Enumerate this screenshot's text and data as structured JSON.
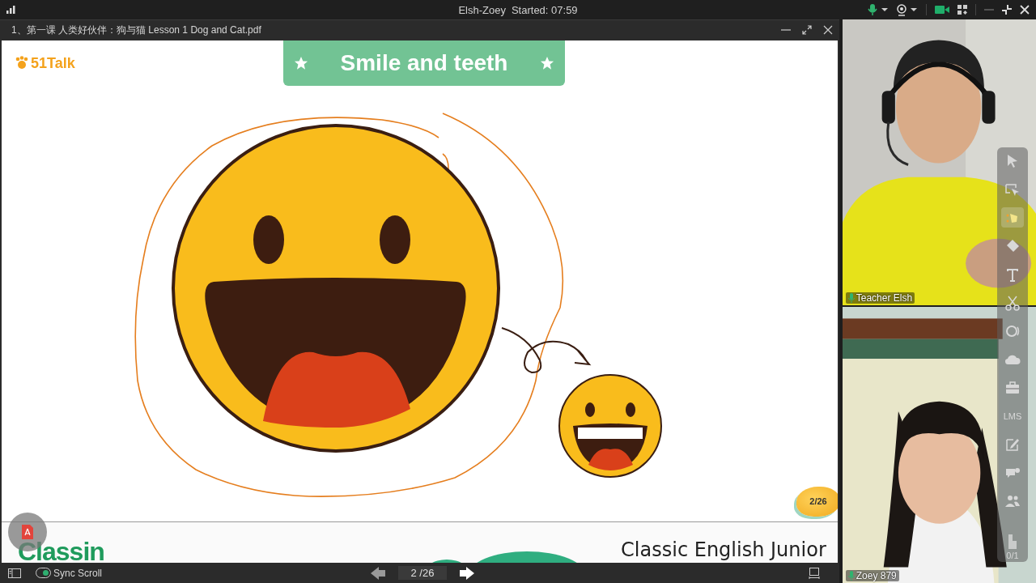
{
  "top_bar": {
    "session": "Elsh-Zoey",
    "started": "Started: 07:59"
  },
  "document": {
    "title": "1、第一课 人类好伙伴：狗与猫 Lesson 1 Dog and Cat.pdf",
    "slide": {
      "brand": "51Talk",
      "heading": "Smile and teeth",
      "page_badge": "2/26",
      "footer_logo": "Classin",
      "footer_text": "Classic English Junior"
    },
    "sync_scroll": {
      "label": "Sync Scroll",
      "on": true
    },
    "page_field": {
      "value": "2 /26"
    }
  },
  "videos": [
    {
      "name": "Teacher Elsh",
      "kind": "picture"
    },
    {
      "name": "Zoey 879",
      "kind": "picture"
    }
  ],
  "tools": [
    {
      "selected": false
    },
    {
      "selected": false
    },
    {
      "selected": true
    },
    {
      "selected": false
    },
    {
      "selected": false
    },
    {
      "selected": false
    },
    {
      "selected": false
    },
    {
      "selected": false
    },
    {
      "selected": false
    },
    {
      "label": "LMS",
      "selected": false
    },
    {
      "selected": false
    },
    {
      "selected": false
    },
    {
      "selected": false
    },
    {
      "count": "0/1",
      "selected": false
    }
  ]
}
